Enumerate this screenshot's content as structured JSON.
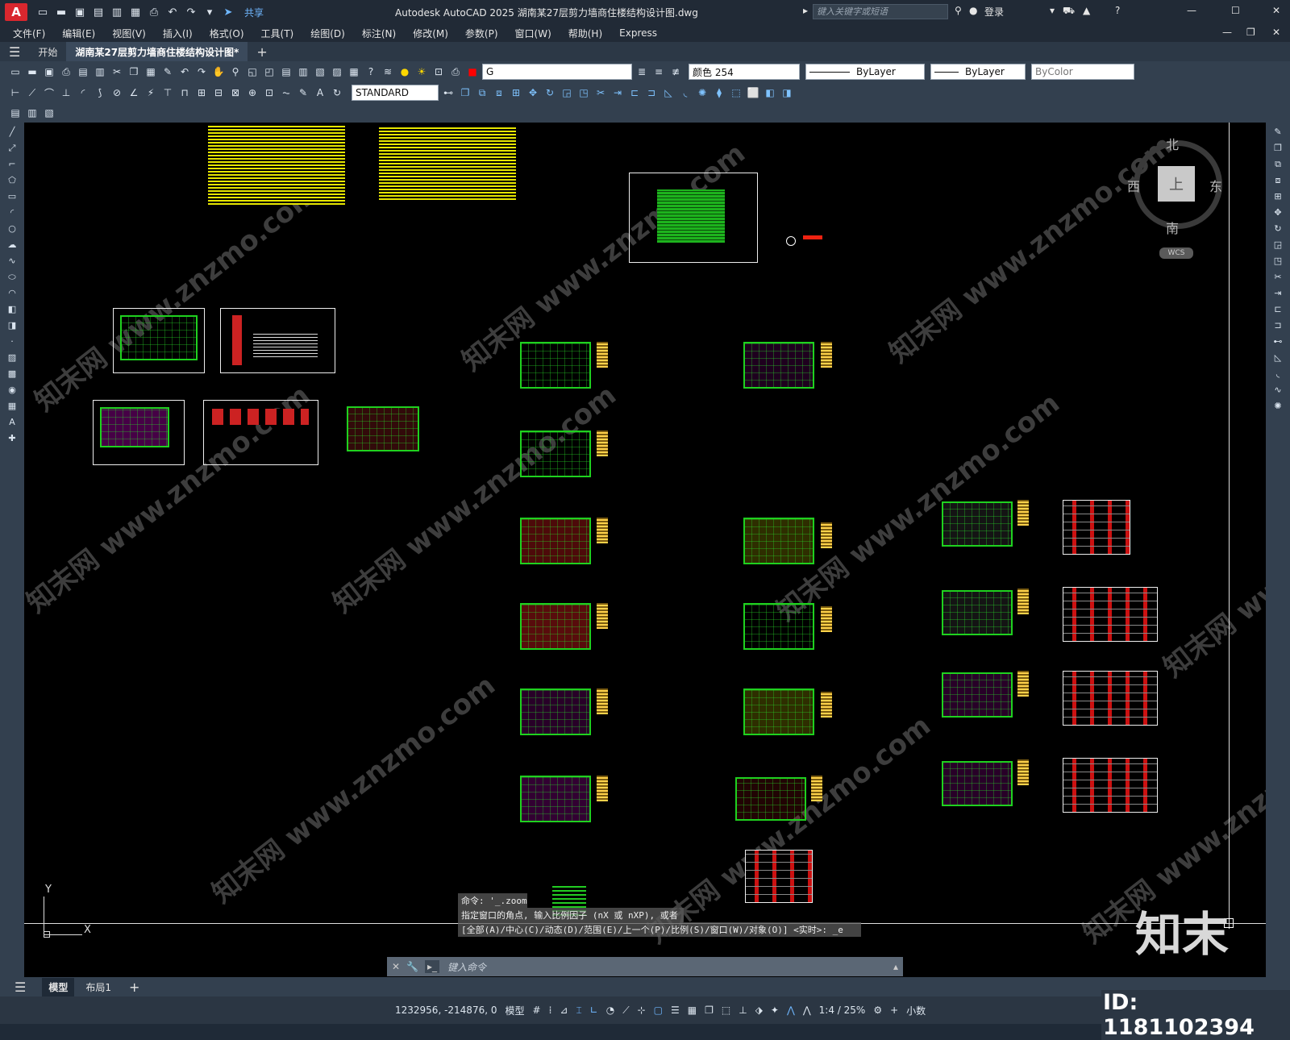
{
  "titlebar": {
    "logo": "A",
    "share": "共享",
    "title": "Autodesk AutoCAD 2025    湖南某27层剪力墙商住楼结构设计图.dwg",
    "search_placeholder": "键入关键字或短语",
    "login": "登录"
  },
  "menu": [
    "文件(F)",
    "编辑(E)",
    "视图(V)",
    "插入(I)",
    "格式(O)",
    "工具(T)",
    "绘图(D)",
    "标注(N)",
    "修改(M)",
    "参数(P)",
    "窗口(W)",
    "帮助(H)",
    "Express"
  ],
  "tabs": {
    "start": "开始",
    "doc": "湖南某27层剪力墙商住楼结构设计图*",
    "add": "+"
  },
  "props": {
    "layer": "G",
    "color": "颜色 254",
    "linetype": "ByLayer",
    "lineweight": "ByLayer",
    "plotstyle": "ByColor",
    "textstyle": "STANDARD"
  },
  "viewcube": {
    "north": "北",
    "south": "南",
    "west": "西",
    "east": "东",
    "top": "上",
    "wcs": "WCS"
  },
  "watermark": {
    "text": "知末网 www.znzmo.com",
    "brand": "知末",
    "id": "ID: 1181102394"
  },
  "ucs": {
    "x": "X",
    "y": "Y"
  },
  "command": {
    "hist1": "命令: '_.zoom",
    "hist2": "指定窗口的角点, 输入比例因子 (nX 或 nXP), 或者",
    "hist3": "[全部(A)/中心(C)/动态(D)/范围(E)/上一个(P)/比例(S)/窗口(W)/对象(O)] <实时>: _e",
    "placeholder": "键入命令"
  },
  "layouts": {
    "model": "模型",
    "layout1": "布局1"
  },
  "status": {
    "coords": "1232956, -214876, 0",
    "model": "模型",
    "scale": "1:4 / 25%",
    "units": "小数"
  }
}
